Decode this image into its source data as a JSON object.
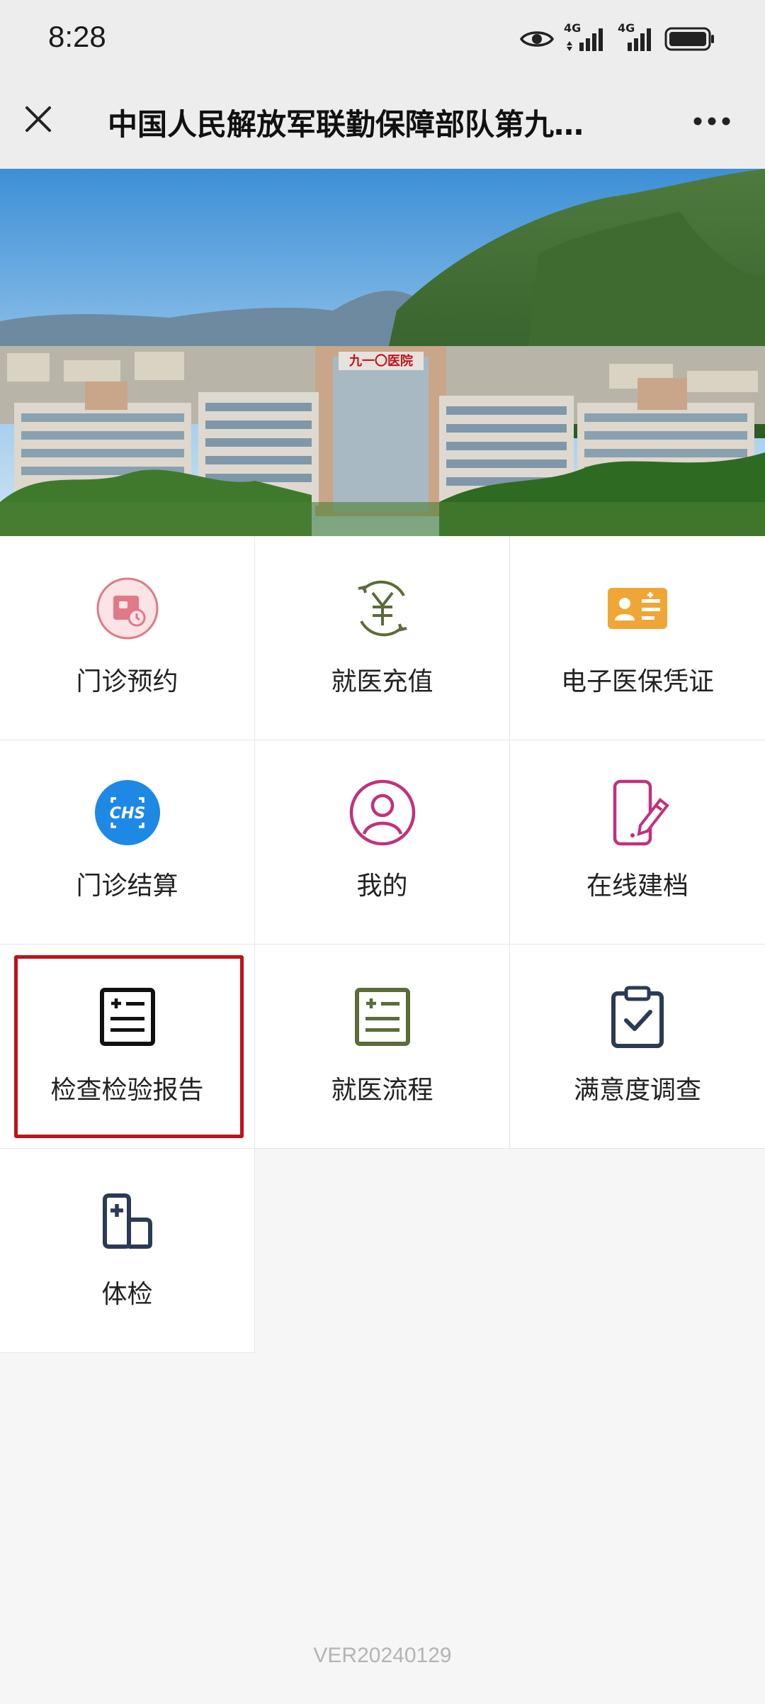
{
  "status_bar": {
    "time": "8:28",
    "network_1": "4G",
    "network_2": "4G",
    "icons": [
      "eye-icon",
      "signal-4g-icon",
      "signal-4g-icon",
      "battery-icon"
    ]
  },
  "title_bar": {
    "title": "中国人民解放军联勤保障部队第九…",
    "close_icon": "close-icon",
    "more_icon": "more-icon"
  },
  "banner": {
    "sign_text": "九一〇医院"
  },
  "menu": {
    "items": [
      {
        "label": "门诊预约",
        "icon": "appointment-icon",
        "color": "#e07a86"
      },
      {
        "label": "就医充值",
        "icon": "yuan-recharge-icon",
        "color": "#5b6b3a"
      },
      {
        "label": "电子医保凭证",
        "icon": "insurance-card-icon",
        "color": "#f0a636"
      },
      {
        "label": "门诊结算",
        "icon": "chs-settlement-icon",
        "color": "#1e88e5"
      },
      {
        "label": "我的",
        "icon": "user-profile-icon",
        "color": "#c2317a"
      },
      {
        "label": "在线建档",
        "icon": "phone-edit-icon",
        "color": "#c2317a"
      },
      {
        "label": "检查检验报告",
        "icon": "report-icon",
        "color": "#111111"
      },
      {
        "label": "就医流程",
        "icon": "process-list-icon",
        "color": "#5b6b3a"
      },
      {
        "label": "满意度调查",
        "icon": "clipboard-check-icon",
        "color": "#2c3a55"
      },
      {
        "label": "体检",
        "icon": "checkup-icon",
        "color": "#2c3a55"
      }
    ]
  },
  "highlight_color": "#c0121c",
  "footer": {
    "version": "VER20240129"
  }
}
